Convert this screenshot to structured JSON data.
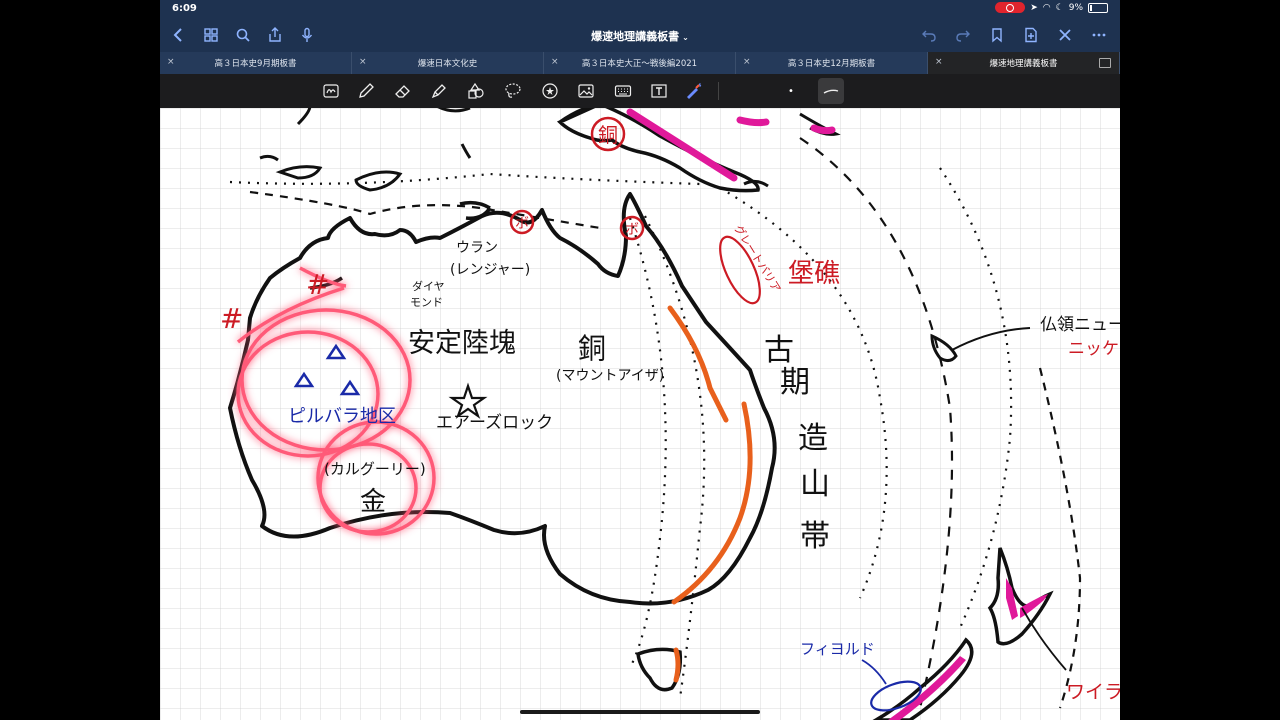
{
  "status_bar": {
    "time": "6:09",
    "battery": "9%"
  },
  "nav": {
    "title": "爆速地理講義板書",
    "title_chevron": "⌄"
  },
  "tabs": [
    {
      "label": "高３日本史9月期板書",
      "active": false
    },
    {
      "label": "爆速日本文化史",
      "active": false
    },
    {
      "label": "高３日本史大正〜戦後編2021",
      "active": false
    },
    {
      "label": "高３日本史12月期板書",
      "active": false
    },
    {
      "label": "爆速地理講義板書",
      "active": true
    }
  ],
  "toolbar": {
    "tools": [
      "lasso-text-icon",
      "pen-icon",
      "eraser-icon",
      "highlighter-icon",
      "shapes-icon",
      "lasso-icon",
      "sticker-icon",
      "image-icon",
      "keyboard-icon",
      "textbox-icon",
      "bluetooth-pencil-icon"
    ],
    "size_dot": "•"
  },
  "map_labels": {
    "uranium": "ウラン",
    "ranger": "(レンジャー)",
    "diamond_1": "ダイヤ",
    "diamond_2": "モンド",
    "craton": "安定陸塊",
    "copper": "銅",
    "mount_isa": "(マウントアイザ)",
    "ayers_rock": "エアーズロック",
    "pilbara": "ピルバラ地区",
    "kalgoorlie": "(カルグーリー)",
    "gold": "金",
    "old_orogenic_1": "古",
    "old_orogenic_2": "期",
    "old_orogenic_3": "造",
    "old_orogenic_4": "山",
    "old_orogenic_5": "帯",
    "great_barrier": "グレートバリア",
    "reef_kanji": "堡礁",
    "bauxite_1": "ボ",
    "bauxite_2": "ボ",
    "copper_circle": "銅",
    "iron_1": "#",
    "iron_2": "#",
    "new_caledonia": "仏領ニューフ",
    "nickel": "ニッケル",
    "fjord": "フィヨルド",
    "wairakei": "ワイラケイ"
  },
  "colors": {
    "nav_bg": "#1e3250",
    "ink_black": "#111111",
    "ink_red": "#cc1b24",
    "ink_blue": "#1a2aa8",
    "ink_orange": "#e8601c",
    "ink_magenta": "#e0199a",
    "glow_pink": "#ff5a78"
  }
}
